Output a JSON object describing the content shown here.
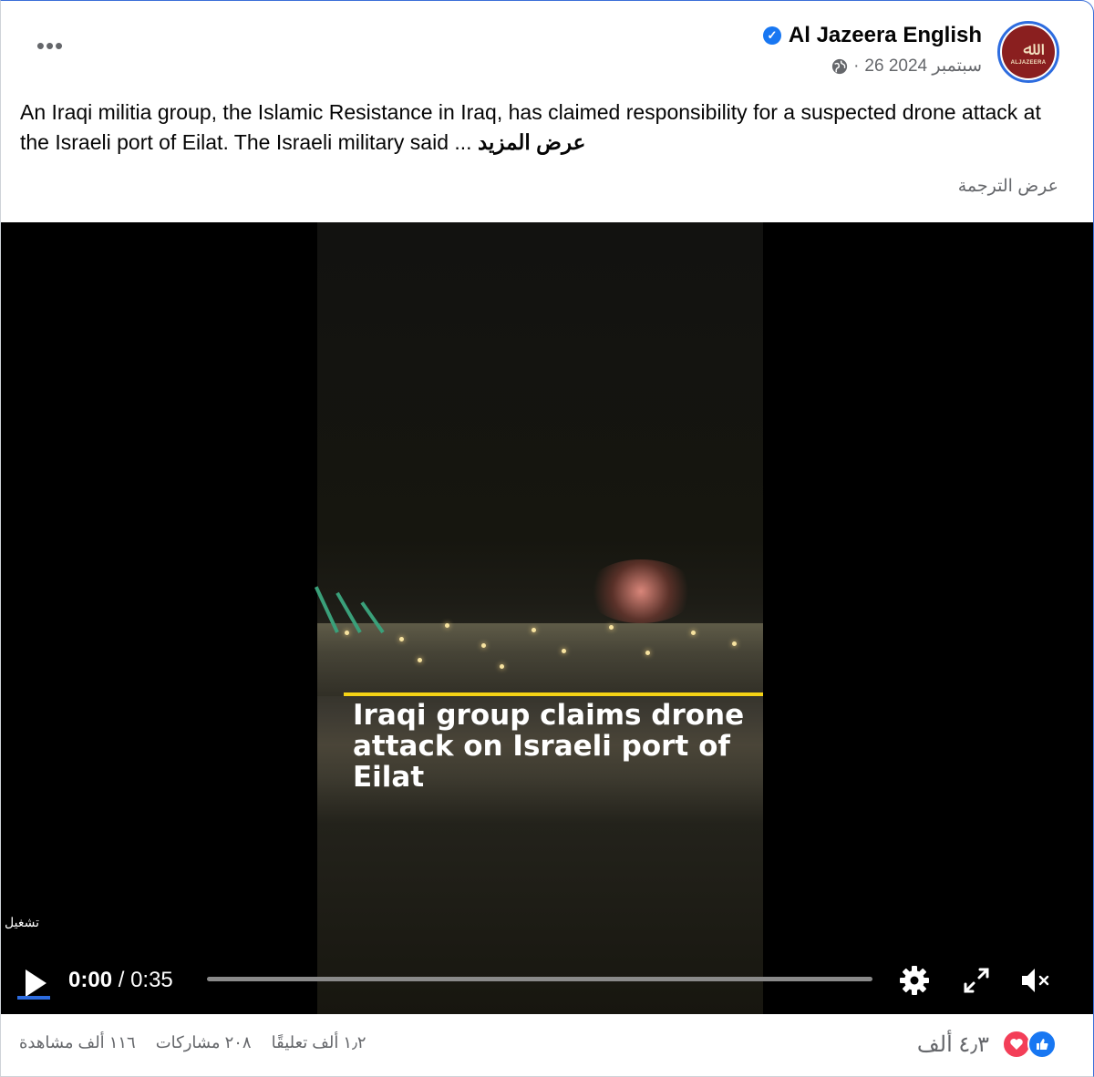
{
  "post": {
    "page_name": "Al Jazeera English",
    "verified": true,
    "date": "26 سبتمبر 2024",
    "meta_separator": "·",
    "avatar_text": "ALJAZEERA",
    "caption": "An Iraqi militia group, the Islamic Resistance in Iraq, has claimed responsibility for a suspected drone attack at the Israeli port of Eilat. The Israeli military said ...",
    "see_more": "عرض المزيد",
    "see_translation": "عرض الترجمة",
    "more_icon": "more-horizontal-icon"
  },
  "video": {
    "overlay_title": "Iraqi group claims drone attack on Israeli port of Eilat",
    "play_hint": "تشغيل",
    "current_time": "0:00",
    "time_separator": "/",
    "duration": "0:35",
    "progress": 0,
    "accent_color": "#f5d315"
  },
  "footer": {
    "reaction_count": "٤٫٣ ألف",
    "comments": "١٫٢ ألف تعليقًا",
    "shares": "٢٠٨ مشاركات",
    "views": "١١٦ ألف مشاهدة"
  },
  "colors": {
    "brand_blue": "#1877f2",
    "love_red": "#f33e58",
    "avatar_bg": "#8a1f1f"
  }
}
